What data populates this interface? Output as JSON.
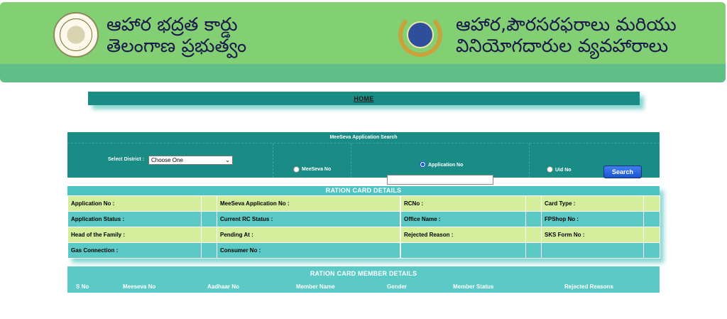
{
  "header": {
    "left_title_line1": "ఆహార భద్రత కార్డు",
    "left_title_line2": "తెలంగాణ ప్రభుత్వం",
    "right_title_line1": "ఆహార,పౌరసరఫరాలు మరియు",
    "right_title_line2": "వినియోగదారుల వ్యవహారాలు",
    "left_logo_icon": "government-emblem-icon",
    "right_logo_icon": "tscsc-logo-icon"
  },
  "nav": {
    "home_label": "HOME"
  },
  "search": {
    "title": "MeeSeva Application Search",
    "district_label": "Select District :",
    "district_value": "Choose One",
    "radio_meeseva": "MeeSeva No",
    "radio_application": "Application No",
    "radio_uid": "Uid No",
    "selected_radio": "Application No",
    "application_input_value": "",
    "button_label": "Search"
  },
  "ration_card": {
    "title": "RATION CARD DETAILS",
    "rows": [
      [
        "Application No :",
        "MeeSeva Application No :",
        "RCNo :",
        "Card Type :"
      ],
      [
        "Application Status :",
        "Current RC Status :",
        "Office Name :",
        "FPShop No :"
      ],
      [
        "Head of the Family :",
        "Pending At :",
        "Rejected Reason :",
        "SKS Form No :"
      ],
      [
        "Gas Connection :",
        "Consumer No :",
        "",
        ""
      ]
    ]
  },
  "members": {
    "title": "RATION CARD MEMBER DETAILS",
    "columns": [
      "S No",
      "Meeseva No",
      "Aadhaar No",
      "Member Name",
      "Gender",
      "Member Status",
      "Rejected Reasons"
    ]
  },
  "colors": {
    "banner_green": "#83cf74",
    "teal_dark": "#1a8c86",
    "teal_light": "#5bc9c5",
    "lime": "#d5ee9c",
    "button_blue": "#1a55d0"
  }
}
